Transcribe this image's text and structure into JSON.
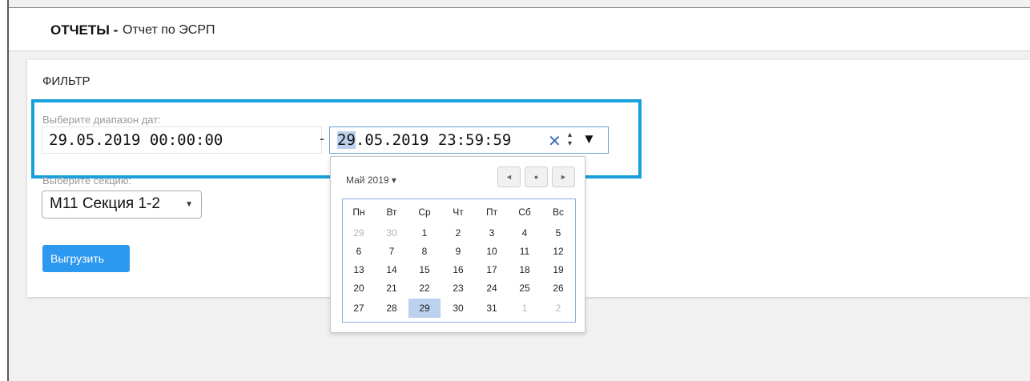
{
  "header": {
    "title": "ОТЧЕТЫ -",
    "subtitle": "Отчет по ЭСРП"
  },
  "filter": {
    "title": "ФИЛЬТР",
    "range_label": "Выберите диапазон дат:",
    "start_value": "29.05.2019 00:00:00",
    "dash": "-",
    "end_day": "29",
    "end_rest": ".05.2019 23:59:59",
    "clear_symbol": "✕",
    "section_label": "Выберите секцию:",
    "section_value": "М11 Секция 1-2",
    "export_label": "Выгрузить"
  },
  "calendar": {
    "month": "Май 2019 ▾",
    "weekdays": [
      "Пн",
      "Вт",
      "Ср",
      "Чт",
      "Пт",
      "Сб",
      "Вс"
    ],
    "weeks": [
      [
        "29",
        "30",
        "1",
        "2",
        "3",
        "4",
        "5"
      ],
      [
        "6",
        "7",
        "8",
        "9",
        "10",
        "11",
        "12"
      ],
      [
        "13",
        "14",
        "15",
        "16",
        "17",
        "18",
        "19"
      ],
      [
        "20",
        "21",
        "22",
        "23",
        "24",
        "25",
        "26"
      ],
      [
        "27",
        "28",
        "29",
        "30",
        "31",
        "1",
        "2"
      ]
    ],
    "selected_day": "29",
    "nav": {
      "prev": "◄",
      "today": "●",
      "next": "►"
    }
  },
  "colors": {
    "highlight": "#18a0dc",
    "button": "#2d98f0",
    "selected_day": "#bcd1ee"
  }
}
